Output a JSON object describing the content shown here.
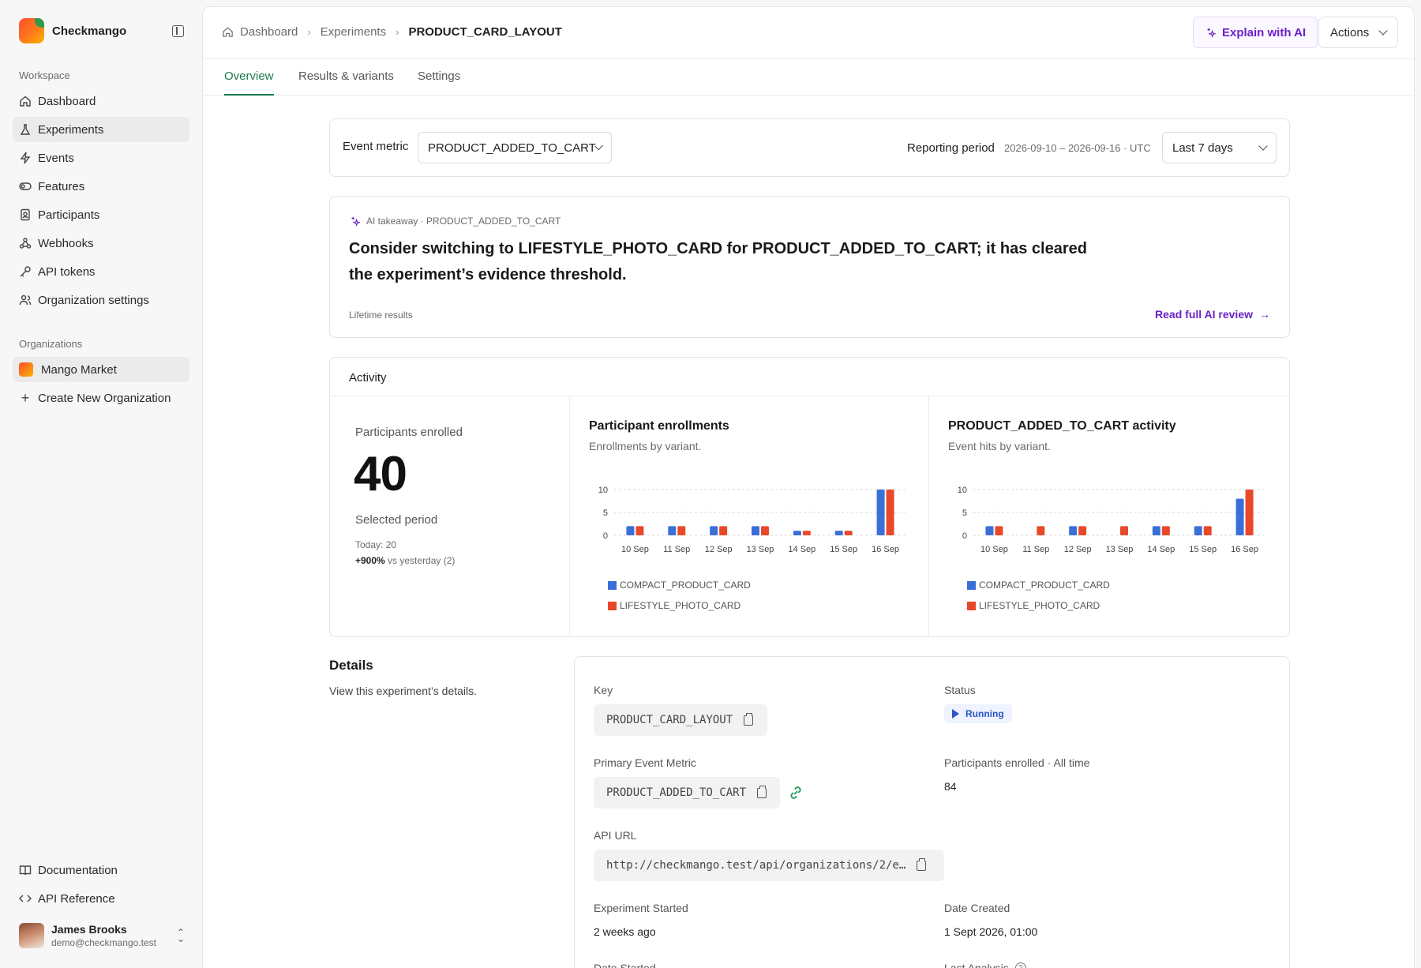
{
  "app": {
    "name": "Checkmango"
  },
  "sidebar": {
    "workspace_label": "Workspace",
    "items": [
      {
        "label": "Dashboard",
        "icon": "home-icon"
      },
      {
        "label": "Experiments",
        "icon": "flask-icon",
        "active": true
      },
      {
        "label": "Events",
        "icon": "bolt-icon"
      },
      {
        "label": "Features",
        "icon": "toggle-icon"
      },
      {
        "label": "Participants",
        "icon": "badge-icon"
      },
      {
        "label": "Webhooks",
        "icon": "webhook-icon"
      },
      {
        "label": "API tokens",
        "icon": "key-icon"
      },
      {
        "label": "Organization settings",
        "icon": "users-icon"
      }
    ],
    "organizations_label": "Organizations",
    "org": {
      "name": "Mango Market"
    },
    "create_org": "Create New Organization",
    "documentation": "Documentation",
    "api_reference": "API Reference",
    "user": {
      "name": "James Brooks",
      "email": "demo@checkmango.test"
    }
  },
  "header": {
    "breadcrumb": [
      "Dashboard",
      "Experiments",
      "PRODUCT_CARD_LAYOUT"
    ],
    "explain_button": "Explain with AI",
    "actions_button": "Actions"
  },
  "tabs": [
    "Overview",
    "Results & variants",
    "Settings"
  ],
  "filters": {
    "event_metric_label": "Event metric",
    "event_metric_value": "PRODUCT_ADDED_TO_CART",
    "reporting_period_label": "Reporting period",
    "reporting_range": "2026-09-10 – 2026-09-16 · UTC",
    "period_select": "Last 7 days"
  },
  "ai_takeaway": {
    "label": "AI takeaway · PRODUCT_ADDED_TO_CART",
    "line1": "Consider switching to LIFESTYLE_PHOTO_CARD for PRODUCT_ADDED_TO_CART; it has cleared",
    "line2": "the experiment’s evidence threshold.",
    "footnote": "Lifetime results",
    "link": "Read full AI review"
  },
  "activity": {
    "title": "Activity",
    "enrolled_label": "Participants enrolled",
    "enrolled_value": "40",
    "period_label": "Selected period",
    "today": "Today: 20",
    "change": "+900%",
    "change_suffix": "vs yesterday (2)"
  },
  "chart_data": [
    {
      "type": "bar",
      "title": "Participant enrollments",
      "subtitle": "Enrollments by variant.",
      "categories": [
        "10 Sep",
        "11 Sep",
        "12 Sep",
        "13 Sep",
        "14 Sep",
        "15 Sep",
        "16 Sep"
      ],
      "series": [
        {
          "name": "COMPACT_PRODUCT_CARD",
          "color": "#3b6fd8",
          "values": [
            2,
            2,
            2,
            2,
            1,
            1,
            10
          ]
        },
        {
          "name": "LIFESTYLE_PHOTO_CARD",
          "color": "#e8492a",
          "values": [
            2,
            2,
            2,
            2,
            1,
            1,
            10
          ]
        }
      ],
      "yticks": [
        0,
        5,
        10
      ],
      "ylim": [
        0,
        10
      ],
      "grid": true,
      "legend": "bottom-left"
    },
    {
      "type": "bar",
      "title": "PRODUCT_ADDED_TO_CART activity",
      "subtitle": "Event hits by variant.",
      "categories": [
        "10 Sep",
        "11 Sep",
        "12 Sep",
        "13 Sep",
        "14 Sep",
        "15 Sep",
        "16 Sep"
      ],
      "series": [
        {
          "name": "COMPACT_PRODUCT_CARD",
          "color": "#3b6fd8",
          "values": [
            2,
            0,
            2,
            0,
            2,
            2,
            8
          ]
        },
        {
          "name": "LIFESTYLE_PHOTO_CARD",
          "color": "#e8492a",
          "values": [
            2,
            2,
            2,
            2,
            2,
            2,
            10
          ]
        }
      ],
      "yticks": [
        0,
        5,
        10
      ],
      "ylim": [
        0,
        10
      ],
      "grid": true,
      "legend": "bottom-left"
    }
  ],
  "details": {
    "title": "Details",
    "subtitle": "View this experiment’s details.",
    "key_label": "Key",
    "key_value": "PRODUCT_CARD_LAYOUT",
    "status_label": "Status",
    "status_value": "Running",
    "metric_label": "Primary Event Metric",
    "metric_value": "PRODUCT_ADDED_TO_CART",
    "enrolled_label": "Participants enrolled · All time",
    "enrolled_value": "84",
    "api_label": "API URL",
    "api_value": "http://checkmango.test/api/organizations/2/e…",
    "started_label": "Experiment Started",
    "started_value": "2 weeks ago",
    "created_label": "Date Created",
    "created_value": "1 Sept 2026, 01:00",
    "date_started_label": "Date Started",
    "last_analysis_label": "Last Analysis"
  }
}
